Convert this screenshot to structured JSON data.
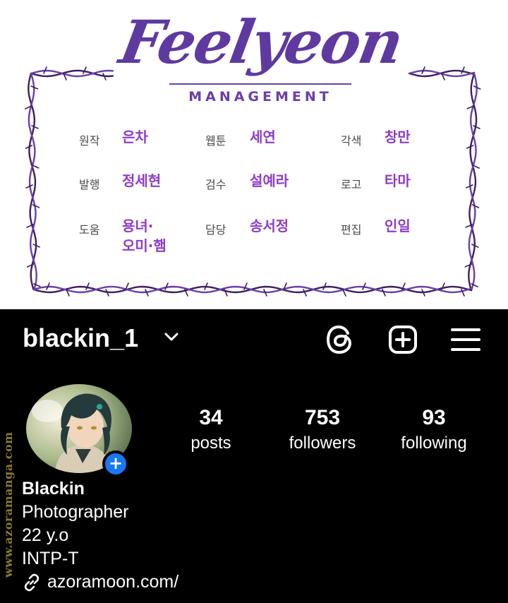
{
  "credits": {
    "logo": {
      "script": "Feelyeon",
      "sub": "MANAGEMENT"
    },
    "rows": [
      [
        {
          "role": "원작",
          "name": "은차"
        },
        {
          "role": "웹툰",
          "name": "세연"
        },
        {
          "role": "각색",
          "name": "창만"
        }
      ],
      [
        {
          "role": "발행",
          "name": "정세현"
        },
        {
          "role": "검수",
          "name": "설예라"
        },
        {
          "role": "로고",
          "name": "타마"
        }
      ],
      [
        {
          "role": "도움",
          "name": "용녀·",
          "name2": "오미·햄"
        },
        {
          "role": "담당",
          "name": "송서정"
        },
        {
          "role": "편집",
          "name": "인일"
        }
      ]
    ],
    "colors": {
      "accent": "#8e3cc7",
      "frame": "#3d1f5e"
    }
  },
  "profile": {
    "username": "blackin_1",
    "icons": {
      "dropdown": "chevron-down-icon",
      "threads": "threads-icon",
      "create": "add-post-icon",
      "menu": "hamburger-menu-icon",
      "add_story": "plus-icon",
      "link": "link-icon"
    },
    "stats": [
      {
        "value": "34",
        "label": "posts"
      },
      {
        "value": "753",
        "label": "followers"
      },
      {
        "value": "93",
        "label": "following"
      }
    ],
    "bio": {
      "name": "Blackin",
      "lines": [
        "Photographer",
        "22 y.o",
        "INTP-T"
      ],
      "link": "azoramoon.com/"
    },
    "add_badge": "+"
  },
  "watermark": "www.azoramanga.com"
}
